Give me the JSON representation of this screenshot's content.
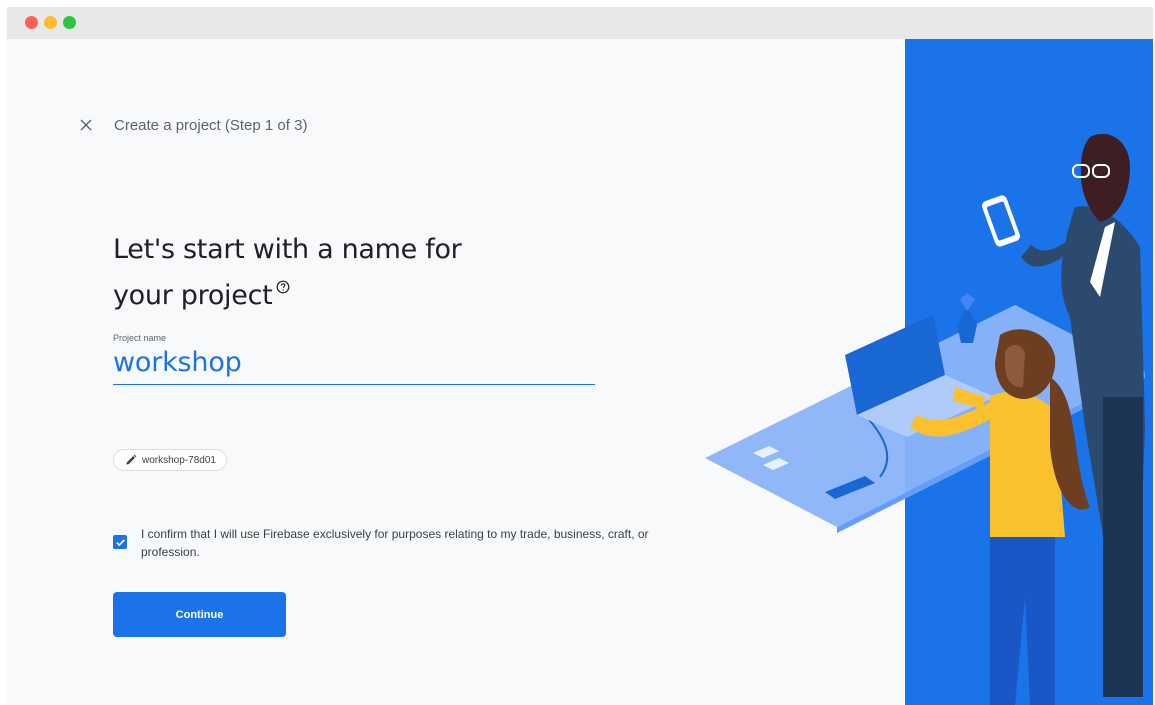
{
  "window": {
    "controls": [
      "close",
      "minimize",
      "maximize"
    ]
  },
  "header": {
    "close_icon": "close-icon",
    "title": "Create a project (Step 1 of 3)"
  },
  "heading": {
    "line1": "Let's start with a name for",
    "line2": "your project",
    "help_icon": "help-circle-icon"
  },
  "project_name": {
    "label": "Project name",
    "value": "workshop"
  },
  "project_id": {
    "icon": "pencil-icon",
    "value": "workshop-78d01"
  },
  "confirm": {
    "checked": true,
    "text": "I confirm that I will use Firebase exclusively for purposes relating to my trade, business, craft, or profession."
  },
  "continue_button": {
    "label": "Continue"
  },
  "colors": {
    "accent": "#1a73e8",
    "background": "#f8f9fa",
    "text_primary": "#202124",
    "text_secondary": "#5f6368"
  }
}
